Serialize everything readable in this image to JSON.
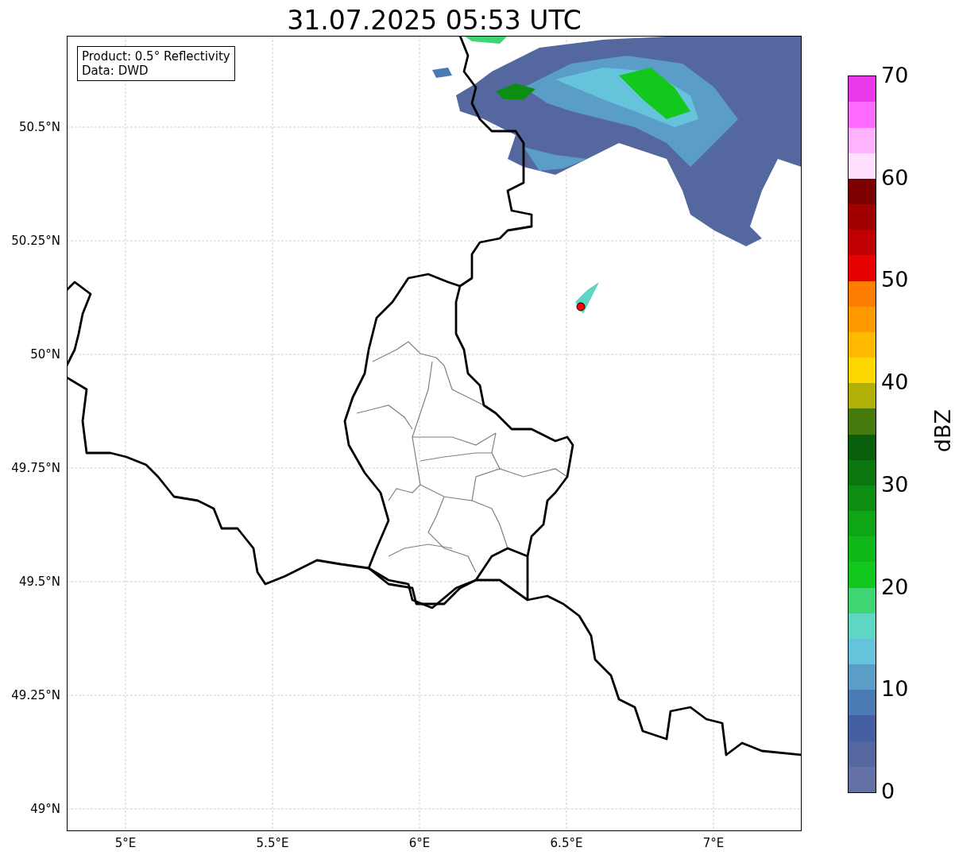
{
  "title": "31.07.2025 05:53 UTC",
  "info_box": [
    "Product: 0.5° Reflectivity",
    "Data: DWD"
  ],
  "map": {
    "lat_ticks": [
      "50.5°N",
      "50.25°N",
      "50°N",
      "49.75°N",
      "49.5°N",
      "49.25°N",
      "49°N"
    ],
    "lon_ticks": [
      "5°E",
      "5.5°E",
      "6°E",
      "6.5°E",
      "7°E"
    ]
  },
  "colorbar": {
    "label": "dBZ",
    "ticks": [
      "70",
      "60",
      "50",
      "40",
      "30",
      "20",
      "10",
      "0"
    ],
    "bins": [
      {
        "color": "#6371a6"
      },
      {
        "color": "#54679e"
      },
      {
        "color": "#4460a3"
      },
      {
        "color": "#4a7bb3"
      },
      {
        "color": "#5a9dc6"
      },
      {
        "color": "#66c3dc"
      },
      {
        "color": "#5fd6c4"
      },
      {
        "color": "#3ed672"
      },
      {
        "color": "#12c81c"
      },
      {
        "color": "#10b81a"
      },
      {
        "color": "#0ea614"
      },
      {
        "color": "#0c8e12"
      },
      {
        "color": "#0a780f"
      },
      {
        "color": "#075e0b"
      },
      {
        "color": "#477a0c"
      },
      {
        "color": "#b0b007"
      },
      {
        "color": "#ffd700"
      },
      {
        "color": "#ffb900"
      },
      {
        "color": "#ff9a00"
      },
      {
        "color": "#ff7d00"
      },
      {
        "color": "#e60000"
      },
      {
        "color": "#c00000"
      },
      {
        "color": "#a00000"
      },
      {
        "color": "#7c0000"
      },
      {
        "color": "#ffe0ff"
      },
      {
        "color": "#ffb3ff"
      },
      {
        "color": "#ff6bff"
      },
      {
        "color": "#ea38ea"
      }
    ]
  }
}
